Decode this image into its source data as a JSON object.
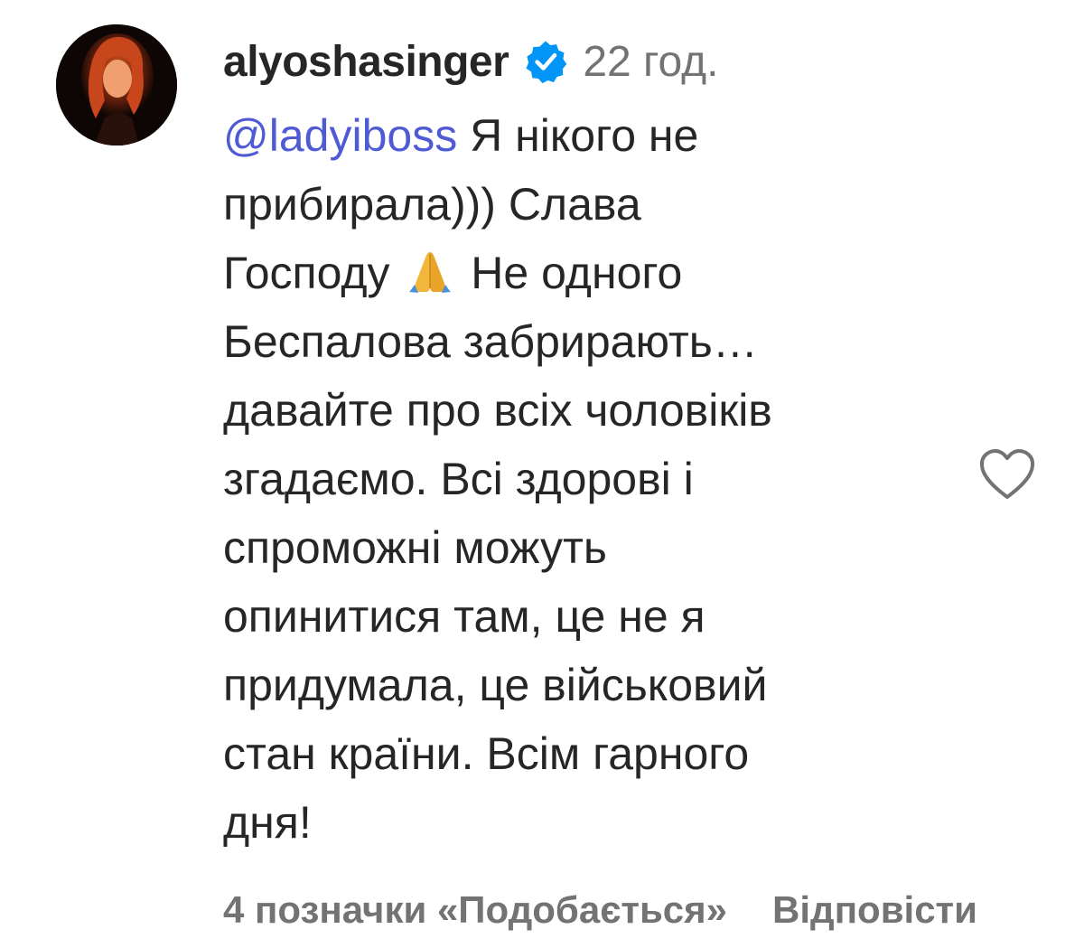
{
  "comment": {
    "avatar_icon": "user-avatar-photo",
    "username": "alyoshasinger",
    "verified_icon": "verified-badge-icon",
    "time": "22 год.",
    "mention": "@ladyiboss",
    "text_lines": [
      " Я нікого не",
      "прибирала))) Слава",
      "Господу ",
      " Не одного",
      "Беспалова забрирають…",
      "давайте про всіх чоловіків",
      "згадаємо. Всі здорові і",
      "спроможні можуть",
      "опинитися там, це не я",
      "придумала, це військовий",
      "стан країни. Всім гарного",
      "дня!"
    ],
    "emoji_icon": "folded-hands-emoji",
    "like_icon": "heart-outline-icon",
    "likes_label": "4 позначки «Подобається»",
    "reply_label": "Відповісти"
  },
  "colors": {
    "mention": "#4f5bd5",
    "verified": "#0095f6",
    "secondary_text": "#737373",
    "primary_text": "#262626"
  }
}
